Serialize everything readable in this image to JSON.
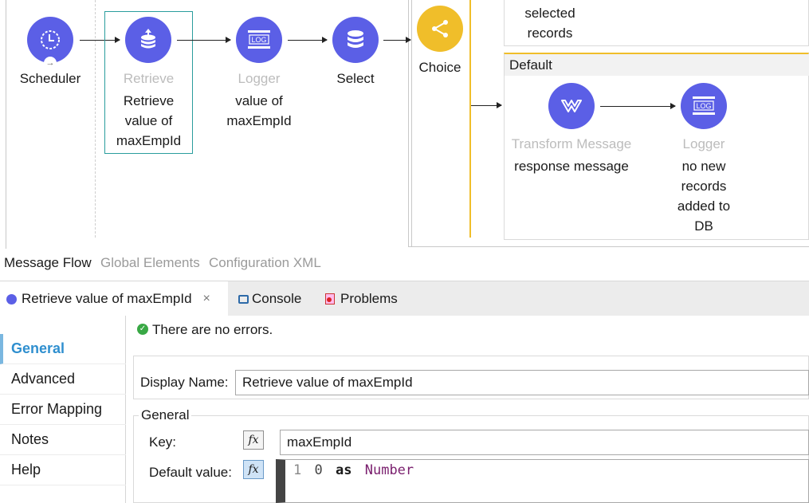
{
  "flow": {
    "nodes": [
      {
        "id": "scheduler",
        "type": "",
        "name": "Scheduler",
        "icon": "clock-icon"
      },
      {
        "id": "retrieve",
        "type": "Retrieve",
        "label": [
          "Retrieve",
          "value of",
          "maxEmpId"
        ],
        "icon": "database-upload-icon",
        "selected": true
      },
      {
        "id": "logger1",
        "type": "Logger",
        "label": [
          "value of",
          "maxEmpId"
        ],
        "icon": "log-icon"
      },
      {
        "id": "select",
        "type": "",
        "name": "Select",
        "icon": "database-icon"
      },
      {
        "id": "choice",
        "type": "",
        "name": "Choice",
        "icon": "choice-icon"
      },
      {
        "id": "transform",
        "type": "Transform Message",
        "label": [
          "response message"
        ],
        "icon": "transform-icon"
      },
      {
        "id": "logger2",
        "type": "Logger",
        "label": [
          "no new",
          "records",
          "added to",
          "DB"
        ],
        "icon": "log-icon"
      }
    ],
    "route_top_text": [
      "selected",
      "records"
    ],
    "default_route_label": "Default",
    "log_text": "LOG"
  },
  "editor_tabs": [
    "Message Flow",
    "Global Elements",
    "Configuration XML"
  ],
  "panel_tabs": [
    {
      "label": "Retrieve value of maxEmpId",
      "close": "×"
    },
    {
      "label": "Console"
    },
    {
      "label": "Problems"
    }
  ],
  "sidebar": [
    "General",
    "Advanced",
    "Error Mapping",
    "Notes",
    "Help"
  ],
  "status": "There are no errors.",
  "form": {
    "display_name_label": "Display Name:",
    "display_name_value": "Retrieve value of maxEmpId",
    "group_title": "General",
    "key_label": "Key:",
    "key_value": "maxEmpId",
    "default_label": "Default value:",
    "fx": "fx",
    "code": {
      "line_no": "1",
      "num": "0",
      "kw": "as",
      "type": "Number"
    }
  },
  "colors": {
    "node": "#5b5fe6",
    "choice": "#f0be2a",
    "selection": "#2a9d9d",
    "sidebar_active": "#2f8fcf",
    "code_kw": "#1a1a1a",
    "code_type": "#7a1f6e"
  }
}
